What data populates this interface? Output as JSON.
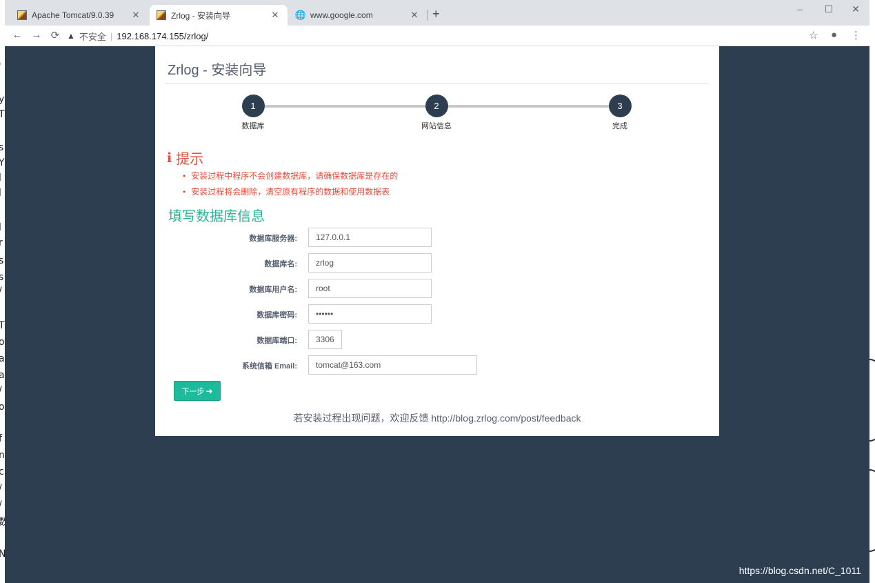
{
  "browser": {
    "tabs": [
      {
        "title": "Apache Tomcat/9.0.39",
        "active": false
      },
      {
        "title": "Zrlog - 安装向导",
        "active": true
      },
      {
        "title": "www.google.com",
        "active": false
      }
    ],
    "new_tab": "+",
    "window_controls": {
      "minimize": "–",
      "maximize": "☐",
      "close": "✕"
    },
    "address": {
      "security_label": "不安全",
      "url": "192.168.174.155/zrlog/"
    }
  },
  "page": {
    "title": "Zrlog - 安装向导",
    "steps": [
      {
        "number": "1",
        "label": "数据库"
      },
      {
        "number": "2",
        "label": "网站信息"
      },
      {
        "number": "3",
        "label": "完成"
      }
    ],
    "tip": {
      "heading": "提示",
      "items": [
        "安装过程中程序不会创建数据库，请确保数据库是存在的",
        "安装过程将会删除，清空原有程序的数据和使用数据表"
      ]
    },
    "section_title": "填写数据库信息",
    "form": {
      "fields": [
        {
          "label": "数据库服务器:",
          "value": "127.0.0.1"
        },
        {
          "label": "数据库名:",
          "value": "zrlog"
        },
        {
          "label": "数据库用户名:",
          "value": "root"
        },
        {
          "label": "数据库密码:",
          "value": "••••••"
        },
        {
          "label": "数据库端口:",
          "value": "3306"
        },
        {
          "label": "系统信箱 Email:",
          "value": "tomcat@163.com"
        }
      ],
      "next_label": "下一步"
    },
    "footer": "若安装过程出现问题，欢迎反馈 http://blog.zrlog.com/post/feedback"
  },
  "watermark": "https://blog.csdn.net/C_1011",
  "colors": {
    "page_bg": "#2c3e50",
    "step_circle": "#2c3e50",
    "tip": "#e74c3c",
    "section_title": "#2bb394",
    "next_button": "#1abc9c"
  }
}
